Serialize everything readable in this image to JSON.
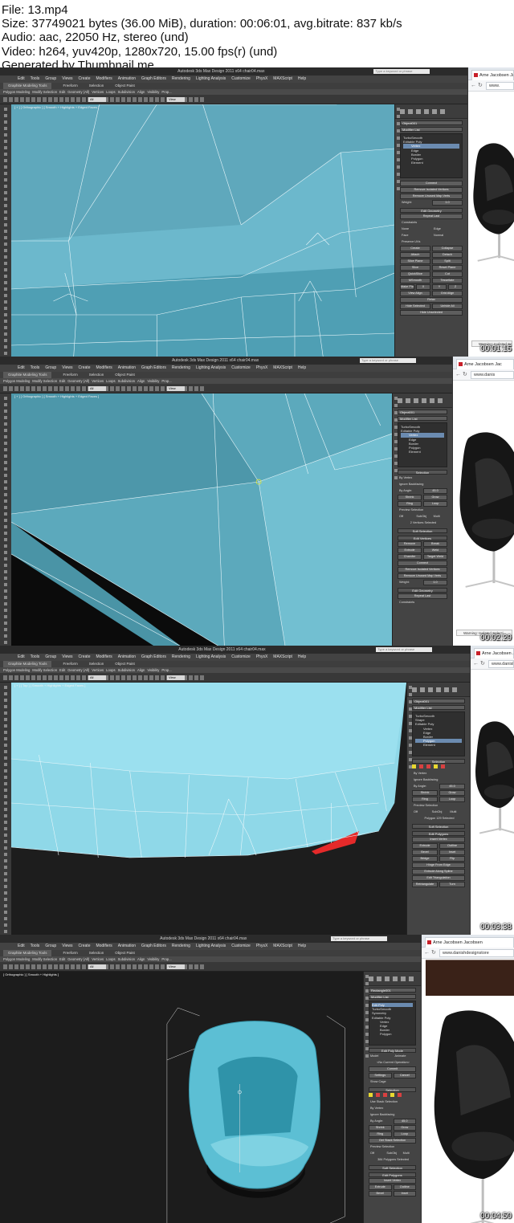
{
  "header": {
    "file": "File: 13.mp4",
    "size": "Size: 37749021 bytes (36.00 MiB), duration: 00:06:01, avg.bitrate: 837 kb/s",
    "audio": "Audio: aac, 22050 Hz, stereo (und)",
    "video": "Video: h264, yuv420p, 1280x720, 15.00 fps(r) (und)",
    "generated": "Generated by Thumbnail me"
  },
  "app": {
    "window_title": "Autodesk 3ds Max Design 2011 x64    chair04.max",
    "search_placeholder": "Type a keyword or phrase",
    "menu": [
      "Edit",
      "Tools",
      "Group",
      "Views",
      "Create",
      "Modifiers",
      "Animation",
      "Graph Editors",
      "Rendering",
      "Lighting Analysis",
      "Customize",
      "PhysX",
      "MAXScript",
      "Help"
    ],
    "ribbon_tabs": [
      "Graphite Modeling Tools",
      "Freeform",
      "Selection",
      "Object Paint"
    ],
    "ribbon_sub": [
      "Polygon Modeling",
      "Modify Selection",
      "Edit",
      "Geometry (All)",
      "Vertices",
      "Loops",
      "Subdivision",
      "Align",
      "Visibility",
      "Prop..."
    ],
    "selection_filter": "All",
    "view_dropdown": "View"
  },
  "frames": [
    {
      "timestamp": "00:01:15",
      "viewport_label": "[ + ] [ Orthographic ] [ Smooth + Highlights + Edged Faces ]",
      "object_name": "Object001",
      "modifier_list": "Modifier List",
      "stack": [
        {
          "label": "TurboSmooth",
          "sub": false,
          "sel": false
        },
        {
          "label": "Editable Poly",
          "sub": false,
          "sel": false
        },
        {
          "label": "Vertex",
          "sub": true,
          "sel": true
        },
        {
          "label": "Edge",
          "sub": true,
          "sel": false
        },
        {
          "label": "Border",
          "sub": true,
          "sel": false
        },
        {
          "label": "Polygon",
          "sub": true,
          "sel": false
        },
        {
          "label": "Element",
          "sub": true,
          "sel": false
        }
      ],
      "panel": {
        "connect": "Connect",
        "remove_isolated": "Remove Isolated Vertices",
        "remove_unused": "Remove Unused Map Verts",
        "weight_label": "Weight:",
        "weight_value": "1.0",
        "edit_geometry": "Edit Geometry",
        "repeat_last": "Repeat Last",
        "constraints": "Constraints",
        "none": "None",
        "edge": "Edge",
        "face": "Face",
        "normal": "Normal",
        "preserve_uvs": "Preserve UVs",
        "create": "Create",
        "collapse": "Collapse",
        "attach": "Attach",
        "detach": "Detach",
        "slice_plane": "Slice Plane",
        "split": "Split",
        "slice": "Slice",
        "reset_plane": "Reset Plane",
        "quickslice": "QuickSlice",
        "cut": "Cut",
        "msmooth": "MSmooth",
        "tessellate": "Tessellate",
        "make_planar": "Make Planar",
        "x": "X",
        "y": "Y",
        "z": "Z",
        "view_align": "View Align",
        "grid_align": "Grid Align",
        "relax": "Relax",
        "hide_selected": "Hide Selected",
        "unhide_all": "Unhide All",
        "hide_unselected": "Hide Unselected"
      },
      "browser": {
        "tab": "Arne Jacobsen Ja",
        "url": "www.",
        "warning": "Warning: Isolated Sele..."
      }
    },
    {
      "timestamp": "00:02:29",
      "viewport_label": "[ + ] [ Orthographic ] [ Smooth + Highlights + Edged Faces ]",
      "object_name": "Object001",
      "modifier_list": "Modifier List",
      "stack": [
        {
          "label": "TurboSmooth",
          "sub": false,
          "sel": false
        },
        {
          "label": "Editable Poly",
          "sub": false,
          "sel": false
        },
        {
          "label": "Vertex",
          "sub": true,
          "sel": true
        },
        {
          "label": "Edge",
          "sub": true,
          "sel": false
        },
        {
          "label": "Border",
          "sub": true,
          "sel": false
        },
        {
          "label": "Polygon",
          "sub": true,
          "sel": false
        },
        {
          "label": "Element",
          "sub": true,
          "sel": false
        }
      ],
      "panel": {
        "selection": "Selection",
        "by_vertex": "By Vertex",
        "ignore_backfacing": "Ignore Backfacing",
        "by_angle": "By Angle:",
        "angle_value": "45.0",
        "shrink": "Shrink",
        "grow": "Grow",
        "ring": "Ring",
        "loop": "Loop",
        "preview_selection": "Preview Selection",
        "off": "Off",
        "subobj": "SubObj",
        "multi": "Multi",
        "status": "2 Vertices Selected",
        "soft_selection": "Soft Selection",
        "edit_vertices": "Edit Vertices",
        "remove": "Remove",
        "break": "Break",
        "extrude": "Extrude",
        "weld": "Weld",
        "chamfer": "Chamfer",
        "target_weld": "Target Weld",
        "connect": "Connect",
        "remove_isolated": "Remove Isolated Vertices",
        "remove_unused": "Remove Unused Map Verts",
        "weight_label": "Weight:",
        "weight_value": "1.0",
        "edit_geometry": "Edit Geometry",
        "repeat_last": "Repeat Last",
        "constraints": "Constraints"
      },
      "browser": {
        "tab": "Arne Jacobsen Jac",
        "url": "www.danis",
        "warning": "Warning: Isolated Selecti..."
      }
    },
    {
      "timestamp": "00:03:38",
      "viewport_label": "[ + ] [ Top ] [ Smooth + Highlights + Edged Faces ]",
      "object_name": "Object001",
      "modifier_list": "Modifier List",
      "stack": [
        {
          "label": "TurboSmooth",
          "sub": false,
          "sel": false
        },
        {
          "label": "Shape",
          "sub": false,
          "sel": false
        },
        {
          "label": "Editable Poly",
          "sub": false,
          "sel": false
        },
        {
          "label": "Vertex",
          "sub": true,
          "sel": false
        },
        {
          "label": "Edge",
          "sub": true,
          "sel": false
        },
        {
          "label": "Border",
          "sub": true,
          "sel": false
        },
        {
          "label": "Polygon",
          "sub": true,
          "sel": true
        },
        {
          "label": "Element",
          "sub": true,
          "sel": false
        }
      ],
      "panel": {
        "selection": "Selection",
        "by_vertex": "By Vertex",
        "ignore_backfacing": "Ignore Backfacing",
        "by_angle": "By Angle:",
        "angle_value": "45.0",
        "shrink": "Shrink",
        "grow": "Grow",
        "ring": "Ring",
        "loop": "Loop",
        "preview_selection": "Preview Selection",
        "off": "Off",
        "subobj": "SubObj",
        "multi": "Multi",
        "status": "Polygon 129 Selected",
        "soft_selection": "Soft Selection",
        "edit_polygons": "Edit Polygons",
        "insert_vertex": "Insert Vertex",
        "extrude": "Extrude",
        "outline": "Outline",
        "bevel": "Bevel",
        "inset": "Inset",
        "bridge": "Bridge",
        "flip": "Flip",
        "hinge": "Hinge From Edge",
        "extrude_spline": "Extrude Along Spline",
        "edit_triangulation": "Edit Triangulation",
        "retriangulate": "Retriangulate",
        "turn": "Turn"
      },
      "browser": {
        "tab": "Arne Jacobsen Jacob",
        "url": "www.danish",
        "warning": ""
      }
    },
    {
      "timestamp": "00:04:50",
      "viewport_label": "[ Orthographic ] [ Smooth + Highlights ]",
      "object_name": "Rectangle001",
      "modifier_list": "Modifier List",
      "stack": [
        {
          "label": "Edit Poly",
          "sub": false,
          "sel": true
        },
        {
          "label": "TurboSmooth",
          "sub": false,
          "sel": false
        },
        {
          "label": "Symmetry",
          "sub": false,
          "sel": false
        },
        {
          "label": "Editable Poly",
          "sub": false,
          "sel": false
        },
        {
          "label": "Vertex",
          "sub": true,
          "sel": false
        },
        {
          "label": "Edge",
          "sub": true,
          "sel": false
        },
        {
          "label": "Border",
          "sub": true,
          "sel": false
        },
        {
          "label": "Polygon",
          "sub": true,
          "sel": false
        }
      ],
      "panel": {
        "edit_poly_mode": "Edit Poly Mode",
        "model": "Model",
        "animate": "Animate",
        "no_operation": "<No Current Operation>",
        "commit": "Commit",
        "settings": "Settings",
        "cancel": "Cancel",
        "show_cage": "Show Cage",
        "selection": "Selection",
        "use_stack_selection": "Use Stack Selection",
        "by_vertex": "By Vertex",
        "ignore_backfacing": "Ignore Backfacing",
        "by_angle": "By Angle:",
        "angle_value": "45.0",
        "shrink": "Shrink",
        "grow": "Grow",
        "ring": "Ring",
        "loop": "Loop",
        "get_stack_selection": "Get Stack Selection",
        "preview_selection": "Preview Selection",
        "off": "Off",
        "subobj": "SubObj",
        "multi": "Multi",
        "status": "384 Polygons Selected",
        "soft_selection": "Soft Selection",
        "edit_polygons": "Edit Polygons",
        "insert_vertex": "Insert Vertex",
        "extrude": "Extrude",
        "outline": "Outline",
        "bevel": "Bevel",
        "inset": "Inset"
      },
      "browser": {
        "tab": "Arne Jacobsen Jacobsen",
        "url": "www.danishdesignstore",
        "warning": ""
      }
    }
  ],
  "colors": {
    "viewport_mesh": "#8fc8d6",
    "selected_face": "#e52a2a",
    "chair_leather": "#1a1a1a",
    "tab_favicon": "#c8202a"
  }
}
